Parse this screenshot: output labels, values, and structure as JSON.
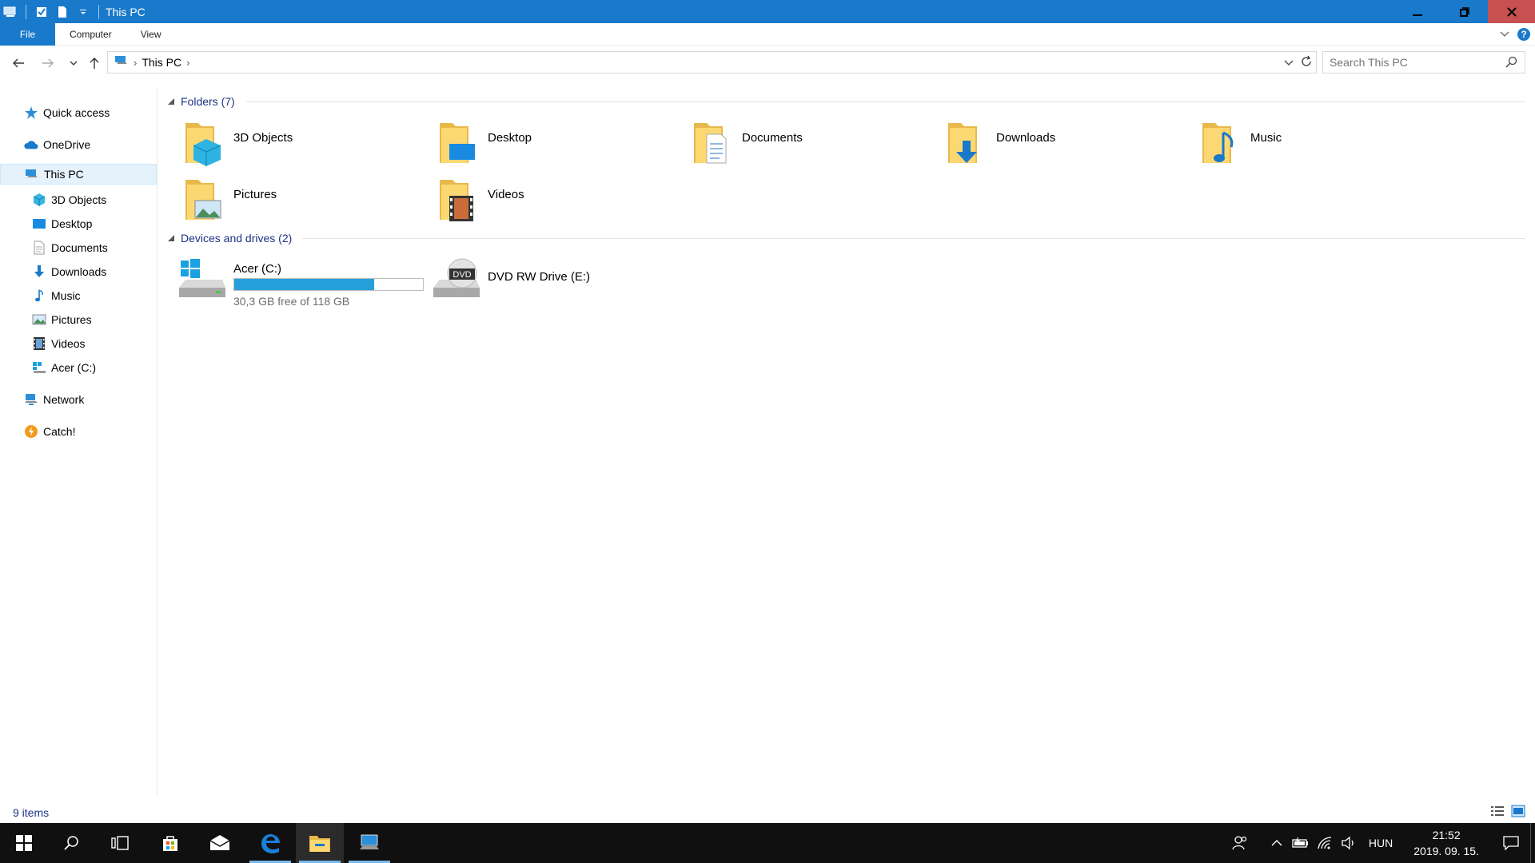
{
  "window": {
    "title": "This PC",
    "accent": "#1979ca"
  },
  "ribbon": {
    "tabs": [
      "File",
      "Computer",
      "View"
    ]
  },
  "address": {
    "crumb": "This PC",
    "search_placeholder": "Search This PC"
  },
  "nav": {
    "quick_access": "Quick access",
    "onedrive": "OneDrive",
    "this_pc": "This PC",
    "children": [
      "3D Objects",
      "Desktop",
      "Documents",
      "Downloads",
      "Music",
      "Pictures",
      "Videos",
      "Acer (C:)"
    ],
    "network": "Network",
    "catch": "Catch!"
  },
  "content": {
    "folders_header": "Folders (7)",
    "folders": [
      "3D Objects",
      "Desktop",
      "Documents",
      "Downloads",
      "Music",
      "Pictures",
      "Videos"
    ],
    "devices_header": "Devices and drives (2)",
    "drives": [
      {
        "name": "Acer (C:)",
        "free_text": "30,3 GB free of 118 GB",
        "used_fraction": 0.74
      },
      {
        "name": "DVD RW Drive (E:)"
      }
    ]
  },
  "status": {
    "items": "9 items"
  },
  "taskbar": {
    "language": "HUN",
    "time": "21:52",
    "date": "2019. 09. 15."
  }
}
